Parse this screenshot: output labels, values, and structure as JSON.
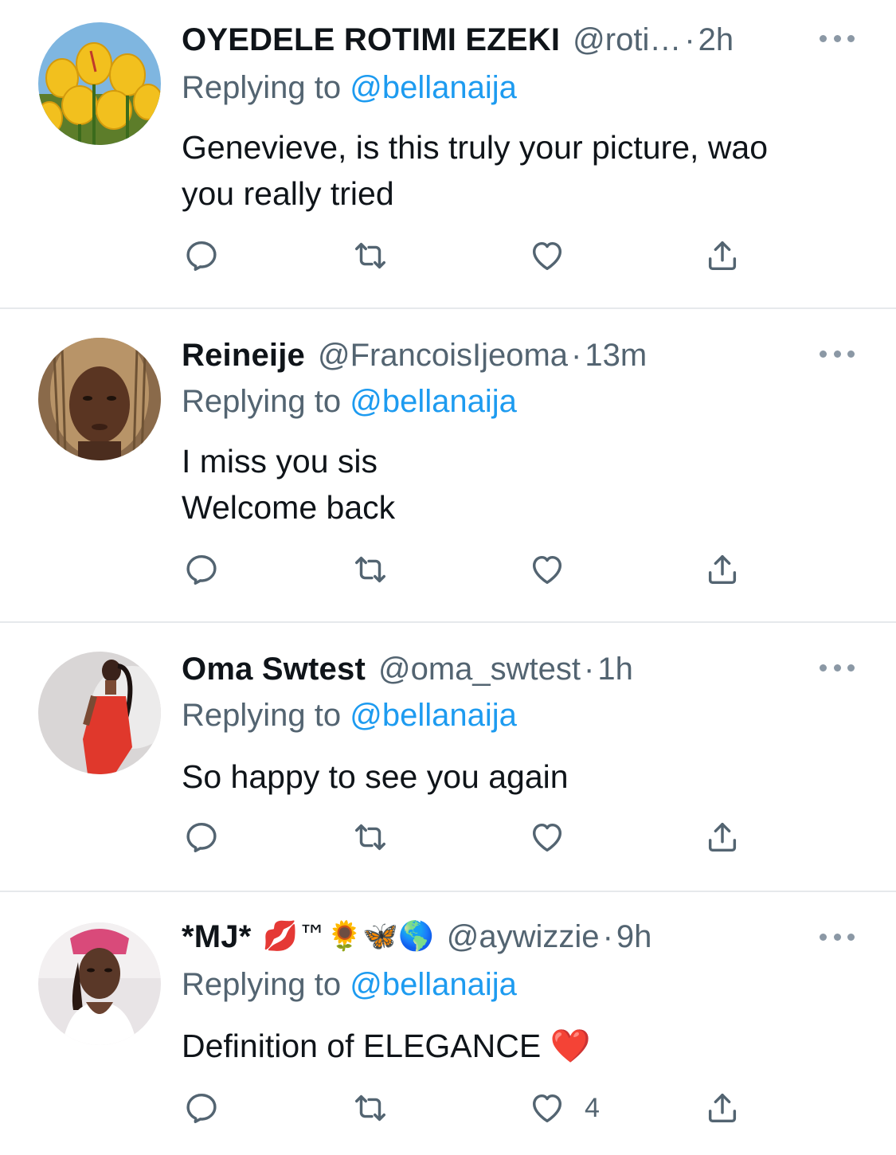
{
  "tweets": [
    {
      "name": "OYEDELE ROTIMI EZEKI",
      "handle": "@roti…",
      "separator": "·",
      "time": "2h",
      "replying_prefix": "Replying to ",
      "replying_to": "@bellanaija",
      "lines": [
        "Genevieve, is this truly your picture, wao",
        "you really tried"
      ],
      "like_count": "",
      "avatar": "tulips"
    },
    {
      "name": "Reineije",
      "handle": "@FrancoisIjeoma",
      "separator": "·",
      "time": "13m",
      "replying_prefix": "Replying to ",
      "replying_to": "@bellanaija",
      "lines": [
        "I miss you sis",
        "Welcome back"
      ],
      "like_count": "",
      "avatar": "portrait-braids"
    },
    {
      "name": "Oma Swtest",
      "handle": "@oma_swtest",
      "separator": "·",
      "time": "1h",
      "replying_prefix": "Replying to ",
      "replying_to": "@bellanaija",
      "lines": [
        "So happy to see you again"
      ],
      "like_count": "",
      "avatar": "red-dress"
    },
    {
      "name": "*MJ*",
      "name_emoji": "💋™🌻🦋🌎",
      "handle": "@aywizzie",
      "separator": "·",
      "time": "9h",
      "replying_prefix": "Replying to ",
      "replying_to": "@bellanaija",
      "lines": [
        "Definition of ELEGANCE ❤️"
      ],
      "like_count": "4",
      "avatar": "selfie"
    }
  ],
  "icons": {
    "reply": "reply-icon",
    "retweet": "retweet-icon",
    "like": "heart-icon",
    "share": "share-icon",
    "more": "more-icon"
  },
  "colors": {
    "text": "#0f1419",
    "secondary": "#536471",
    "link": "#1d9bf0",
    "divider": "#e6e9ec"
  }
}
